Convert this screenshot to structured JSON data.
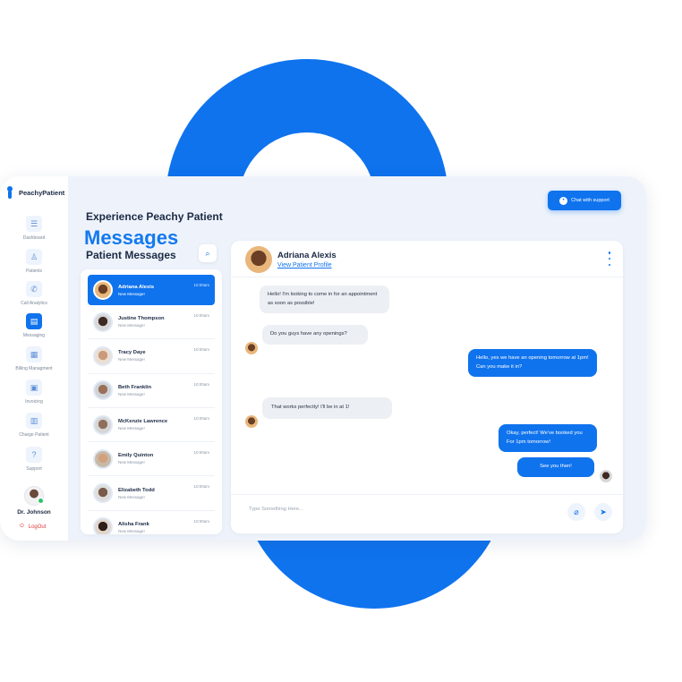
{
  "app": {
    "logo_text": "PeachyPatient",
    "brand_title": "Experience Peachy Patient",
    "support_button": "Chat with support"
  },
  "sidebar": {
    "items": [
      {
        "label": "Dashboard",
        "icon": "grid-icon"
      },
      {
        "label": "Patients",
        "icon": "user-icon"
      },
      {
        "label": "Call Analytics",
        "icon": "phone-icon"
      },
      {
        "label": "Messaging",
        "icon": "message-icon"
      },
      {
        "label": "Billing Managment",
        "icon": "bill-icon"
      },
      {
        "label": "Invoicing",
        "icon": "invoice-icon"
      },
      {
        "label": "Charge Patient",
        "icon": "charge-icon"
      },
      {
        "label": "Support",
        "icon": "help-icon"
      }
    ],
    "active_index": 3,
    "user_name": "Dr. Johnson",
    "logout_label": "LogOut"
  },
  "messages": {
    "page_title": "Messages",
    "section_title": "Patient Messages",
    "list": [
      {
        "name": "Adriana Alexis",
        "sub": "New Message!",
        "time": "10:00am"
      },
      {
        "name": "Justine Thompson",
        "sub": "New Message!",
        "time": "10:00am"
      },
      {
        "name": "Tracy Daye",
        "sub": "New Message!",
        "time": "10:00am"
      },
      {
        "name": "Beth Franklin",
        "sub": "New Message!",
        "time": "10:00am"
      },
      {
        "name": "McKenzie Lawrence",
        "sub": "New Message!",
        "time": "10:00am"
      },
      {
        "name": "Emily Quinton",
        "sub": "New Message!",
        "time": "10:00am"
      },
      {
        "name": "Elizabeth Todd",
        "sub": "New Message!",
        "time": "10:00am"
      },
      {
        "name": "Alisha Frank",
        "sub": "New Message!",
        "time": "10:00am"
      }
    ]
  },
  "chat": {
    "contact_name": "Adriana Alexis",
    "profile_link": "View Patient Profile",
    "messages": [
      {
        "text": "Hello! I'm looking to come in for an appointment as soon as possible!",
        "from": "patient"
      },
      {
        "text": "Do you guys have any openings?",
        "from": "patient"
      },
      {
        "text": "Hello, yes we have an opening tomorrow at 1pm! Can you make it in?",
        "from": "staff"
      },
      {
        "text": "That works perfectly! I'll be in at 1!",
        "from": "patient"
      },
      {
        "text": "Okay, perfect! We've booked you For 1pm tomorrow!",
        "from": "staff"
      },
      {
        "text": "See you then!",
        "from": "staff"
      }
    ],
    "input_placeholder": "Type Something Here..."
  },
  "colors": {
    "accent": "#0f73ee",
    "background": "#eef3fb",
    "logout": "#e33b3b",
    "online": "#2ec36b"
  }
}
